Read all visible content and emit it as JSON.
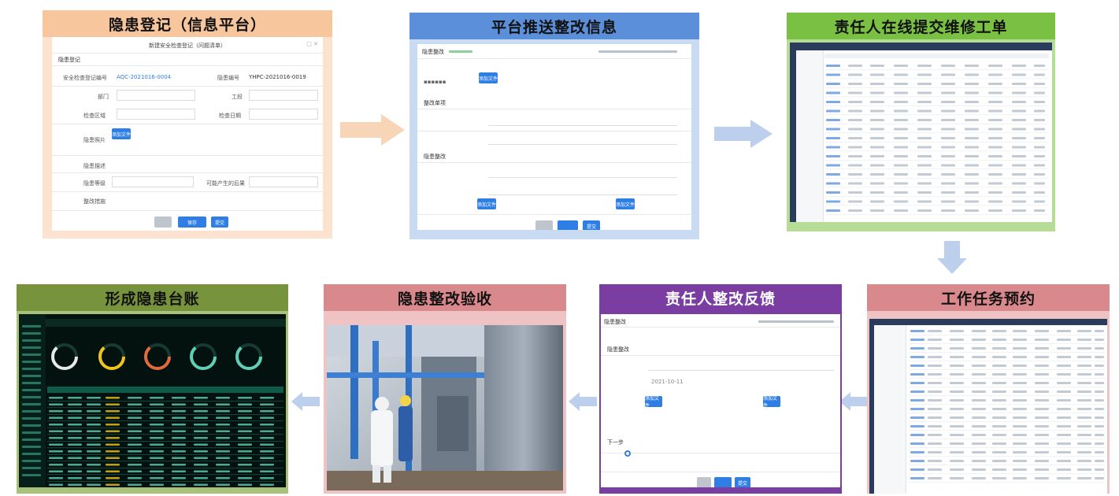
{
  "steps": [
    {
      "title": "隐患登记（信息平台）",
      "header_color": "#f8c69c",
      "frame_color": "#fde3cf"
    },
    {
      "title": "平台推送整改信息",
      "header_color": "#5b8fd9",
      "frame_color": "#c9daf3"
    },
    {
      "title": "责任人在线提交维修工单",
      "header_color": "#7ac143",
      "frame_color": "#b7dc97"
    },
    {
      "title": "工作任务预约",
      "header_color": "#d9898b",
      "frame_color": "#efc2c3"
    },
    {
      "title": "责任人整改反馈",
      "header_color": "#7a3ea3",
      "frame_color": "#7a3ea3"
    },
    {
      "title": "隐患整改验收",
      "header_color": "#d9898b",
      "frame_color": "#efc2c3"
    },
    {
      "title": "形成隐患台账",
      "header_color": "#77933c",
      "frame_color": "#a9c27a"
    }
  ],
  "form1": {
    "window_title": "新建安全检查登记（问题清单）",
    "section": "隐患登记",
    "check_no_label": "安全检查登记编号",
    "check_no_value": "AQC-2021016-0004",
    "hazard_no_label": "隐患编号",
    "hazard_no_value": "YHPC-2021016-0019",
    "dept_label": "部门",
    "type_label": "工段",
    "area_label": "检查区域",
    "date_label": "检查日期",
    "photo_label": "隐患照片",
    "desc_label": "隐患描述",
    "level_label": "隐患等级",
    "cause_label": "可能产生的后果",
    "measure_label": "整改措施",
    "upload_label": "添加文件",
    "cancel_label": "取消",
    "save_label": "保存",
    "submit_label": "提交"
  },
  "form2": {
    "title": "隐患整改",
    "upload_label": "添加文件",
    "section_a": "整改单项",
    "section_b": "隐患整改",
    "cancel_label": "取消",
    "submit_label": "提交"
  },
  "form5": {
    "title": "隐患整改",
    "section": "隐患整改",
    "date_value": "2021-10-11",
    "upload_label": "添加文件",
    "next_label": "下一步",
    "submit_label": "提交"
  }
}
